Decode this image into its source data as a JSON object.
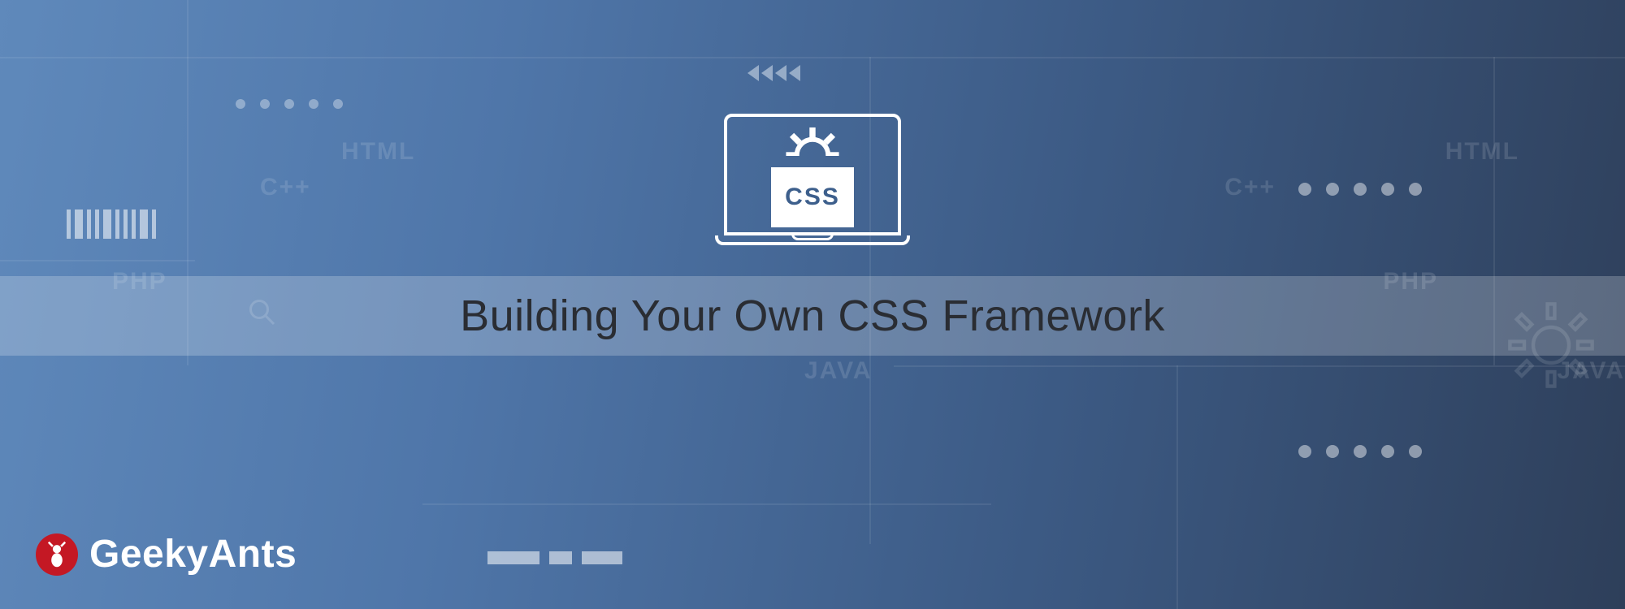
{
  "title": "Building Your Own CSS Framework",
  "css_badge_label": "CSS",
  "brand": {
    "name": "GeekyAnts"
  },
  "bg_labels": {
    "html": "HTML",
    "cpp": "C++",
    "php": "PHP",
    "java": "JAVA"
  }
}
